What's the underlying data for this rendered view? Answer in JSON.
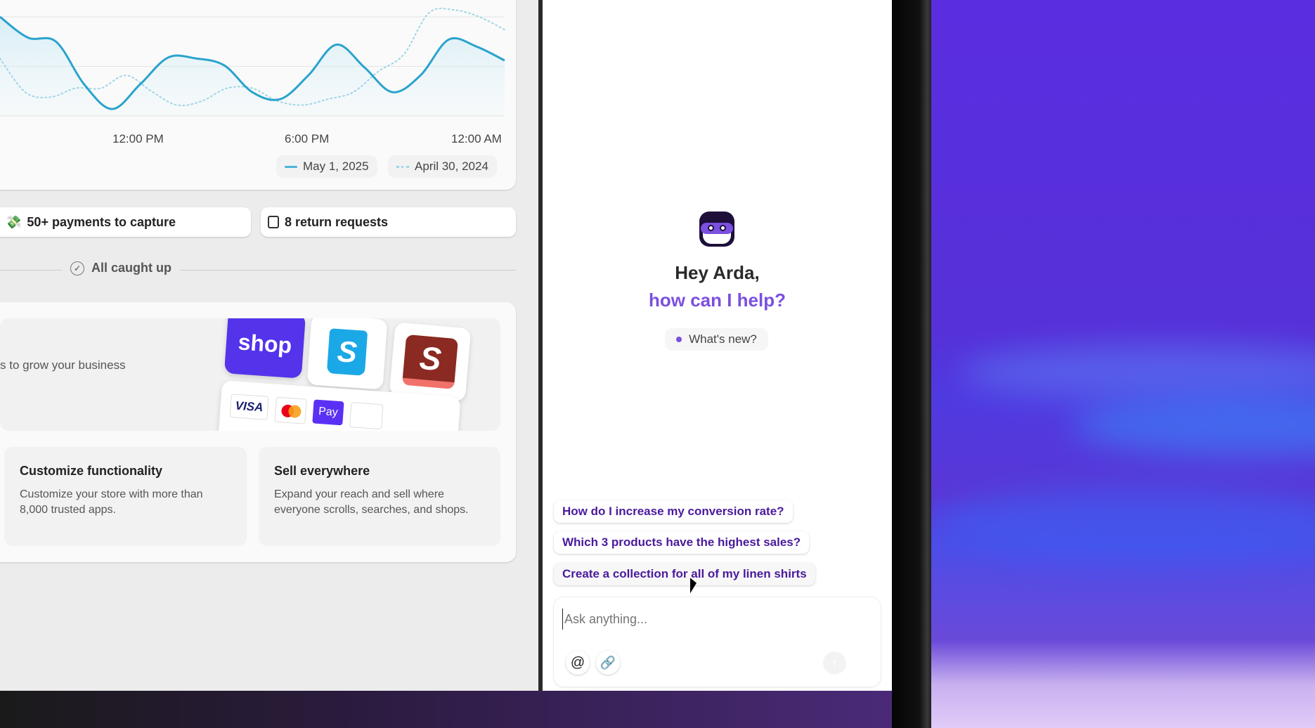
{
  "chart_data": {
    "type": "line",
    "x_ticks": [
      "12:00 PM",
      "6:00 PM",
      "12:00 AM"
    ],
    "ylim": [
      0,
      110
    ],
    "series": [
      {
        "name": "May 1, 2025",
        "style": "solid",
        "color": "#2aa3cc",
        "values": [
          100,
          79,
          75,
          32,
          7,
          32,
          59,
          58,
          51,
          24,
          17,
          41,
          72,
          49,
          24,
          41,
          77,
          70,
          56
        ]
      },
      {
        "name": "April 30, 2024",
        "style": "dotted",
        "color": "#9fd6e6",
        "values": [
          58,
          24,
          19,
          28,
          28,
          41,
          25,
          11,
          15,
          28,
          28,
          15,
          11,
          17,
          24,
          45,
          62,
          104,
          107,
          100,
          87
        ]
      }
    ],
    "legend_placement": "bottom-right"
  },
  "actions": [
    {
      "label": "50+ payments to capture",
      "icon": "payments-icon"
    },
    {
      "label": "8 return requests",
      "icon": "returns-icon"
    }
  ],
  "caught_up": "All caught up",
  "promo": {
    "text": "s to grow your business",
    "logos": {
      "shop": "shop",
      "shopify": "S",
      "shopify_email": "S",
      "visa": "VISA",
      "pay": "Pay"
    },
    "features": [
      {
        "title": "Customize functionality",
        "desc": "Customize your store with more than 8,000 trusted apps."
      },
      {
        "title": "Sell everywhere",
        "desc": "Expand your reach and sell where everyone scrolls, searches, and shops."
      }
    ]
  },
  "chat": {
    "greeting": "Hey Arda,",
    "prompt": "how can I help?",
    "whats_new": "What's new?",
    "suggestions": [
      "How do I increase my conversion rate?",
      "Which 3 products have the highest sales?",
      "Create a collection for all of my linen shirts"
    ],
    "input_placeholder": "Ask anything...",
    "accent": "#7b4fe0"
  }
}
